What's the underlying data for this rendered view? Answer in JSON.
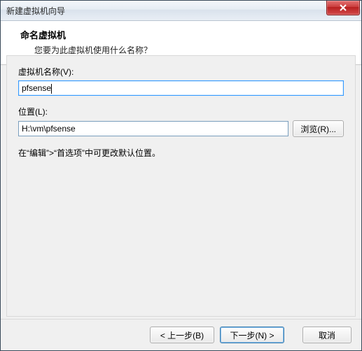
{
  "window": {
    "title": "新建虚拟机向导"
  },
  "header": {
    "title": "命名虚拟机",
    "subtitle": "您要为此虚拟机使用什么名称？"
  },
  "fields": {
    "name_label": "虚拟机名称(V):",
    "name_value": "pfsense",
    "location_label": "位置(L):",
    "location_value": "H:\\vm\\pfsense",
    "browse_label": "浏览(R)..."
  },
  "hint": "在“编辑”>“首选项”中可更改默认位置。",
  "footer": {
    "back": "< 上一步(B)",
    "next": "下一步(N) >",
    "cancel": "取消"
  }
}
